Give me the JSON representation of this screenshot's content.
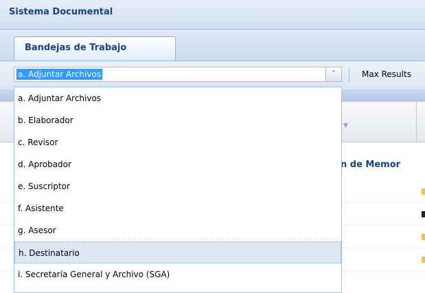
{
  "app": {
    "title": "Sistema Documental"
  },
  "tabs": [
    {
      "label": "Bandejas de Trabajo",
      "active": true
    }
  ],
  "toolbar": {
    "combo_value": "a. Adjuntar Archivos",
    "max_results_label": "Max Results"
  },
  "dropdown": {
    "highlighted_index": 7,
    "items": [
      "a. Adjuntar Archivos",
      "b. Elaborador",
      "c. Revisor",
      "d. Aprobador",
      "e. Suscriptor",
      "f. Asistente",
      "g. Asesor",
      "h. Destinatario",
      "i. Secretaría General y Archivo (SGA)"
    ]
  },
  "grid": {
    "partial_column_title": "n de Memor",
    "row_marker_colors": [
      "#f0c050",
      "#222222",
      "#f0c050",
      "#f0c050"
    ]
  },
  "colors": {
    "header_text": "#15428b",
    "selection_blue": "#3399ff",
    "panel_bg": "#dfe8f6"
  },
  "icons": {
    "combo_trigger": "chevron-down-icon",
    "sort_arrow": "sort-arrow-icon"
  }
}
